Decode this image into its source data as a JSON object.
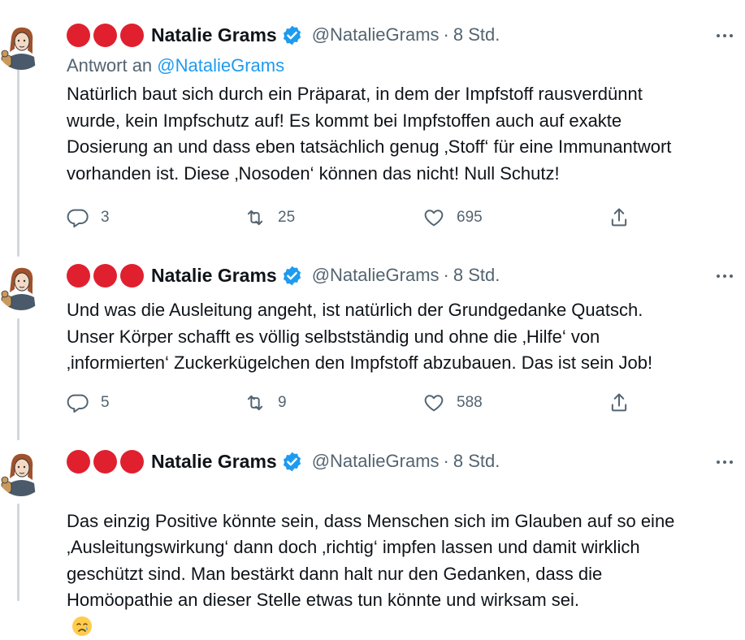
{
  "tweets": [
    {
      "author": {
        "name": "Natalie Grams",
        "handle": "@NatalieGrams",
        "time": "8 Std.",
        "name_prefix_emoji": "three red circles"
      },
      "reply_to": {
        "label": "Antwort an",
        "mention": "@NatalieGrams"
      },
      "text": "Natürlich baut sich durch ein  Präparat, in dem der Impfstoff rausverdünnt\nwurde, kein Impfschutz auf! Es kommt bei Impfstoffen auch auf exakte\nDosierung an und dass eben tatsächlich genug ‚Stoff‘ für eine Immunantwort\nvorhanden ist. Diese ‚Nosoden‘ können das nicht! Null Schutz!",
      "stats": {
        "replies": "3",
        "retweets": "25",
        "likes": "695"
      }
    },
    {
      "author": {
        "name": "Natalie Grams",
        "handle": "@NatalieGrams",
        "time": "8 Std.",
        "name_prefix_emoji": "three red circles"
      },
      "text": "Und was die Ausleitung angeht, ist natürlich der Grundgedanke Quatsch.\nUnser Körper schafft es völlig selbstständig und ohne die ‚Hilfe‘ von\n‚informierten‘ Zuckerkügelchen den Impfstoff abzubauen. Das ist sein Job!",
      "stats": {
        "replies": "5",
        "retweets": "9",
        "likes": "588"
      }
    },
    {
      "author": {
        "name": "Natalie Grams",
        "handle": "@NatalieGrams",
        "time": "8 Std.",
        "name_prefix_emoji": "three red circles"
      },
      "text": "Das einzig Positive könnte sein, dass Menschen sich im Glauben auf so eine\n‚Ausleitungswirkung‘ dann doch ‚richtig‘ impfen lassen und damit wirklich\ngeschützt sind. Man bestärkt dann halt nur den Gedanken, dass die\nHomöopathie an dieser Stelle etwas tun könnte und wirksam sei.",
      "trailing_emoji": "crying-face",
      "stats": null
    }
  ],
  "separator": "·",
  "colors": {
    "accent": "#1d9bf0",
    "muted": "#536471",
    "text": "#0f1419",
    "red": "#e0202f",
    "line": "#cfd9de"
  },
  "icons": [
    "reply-icon",
    "retweet-icon",
    "like-icon",
    "share-icon",
    "verified-badge-icon",
    "more-icon",
    "avatar-illustration"
  ]
}
